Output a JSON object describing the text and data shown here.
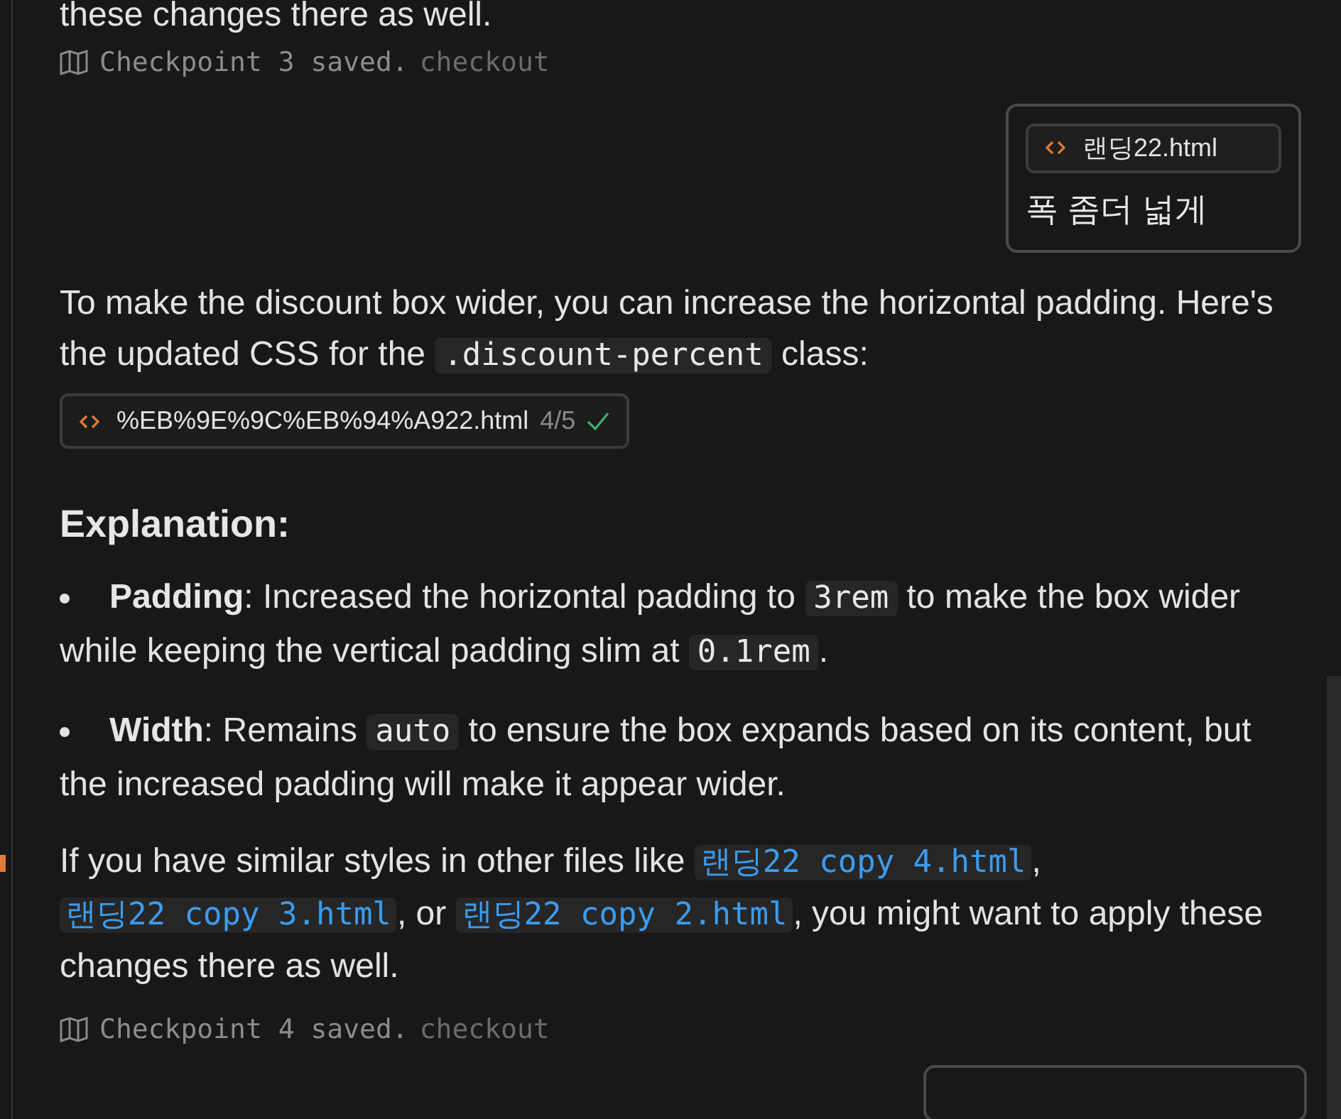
{
  "blocks": [
    {
      "kind": "paragraph",
      "segments": [
        {
          "kind": "text",
          "text": "these changes there as well."
        }
      ]
    },
    {
      "kind": "checkpoint",
      "text": "Checkpoint 3 saved.",
      "action": "checkout"
    },
    {
      "kind": "user_message",
      "file": "랜딩22.html",
      "text": "폭 좀더 넓게"
    },
    {
      "kind": "paragraph",
      "segments": [
        {
          "kind": "text",
          "text": "To make the discount box wider, you can increase the horizontal padding. Here's the updated CSS for the "
        },
        {
          "kind": "code",
          "text": ".discount-percent"
        },
        {
          "kind": "text",
          "text": " class:"
        }
      ]
    },
    {
      "kind": "file_chip",
      "file": "%EB%9E%9C%EB%94%A922.html",
      "count": "4/5",
      "applied": true
    },
    {
      "kind": "heading",
      "text": "Explanation:"
    },
    {
      "kind": "bullet",
      "segments": [
        {
          "kind": "bold",
          "text": "Padding"
        },
        {
          "kind": "text",
          "text": ": Increased the horizontal padding to "
        },
        {
          "kind": "code",
          "text": "3rem"
        },
        {
          "kind": "text",
          "text": " to make the box wider while keeping the vertical padding slim at "
        },
        {
          "kind": "code",
          "text": "0.1rem"
        },
        {
          "kind": "text",
          "text": "."
        }
      ]
    },
    {
      "kind": "bullet",
      "segments": [
        {
          "kind": "bold",
          "text": "Width"
        },
        {
          "kind": "text",
          "text": ": Remains "
        },
        {
          "kind": "code",
          "text": "auto"
        },
        {
          "kind": "text",
          "text": " to ensure the box expands based on its content, but the increased padding will make it appear wider."
        }
      ]
    },
    {
      "kind": "paragraph",
      "segments": [
        {
          "kind": "text",
          "text": "If you have similar styles in other files like "
        },
        {
          "kind": "link",
          "text": "랜딩22 copy 4.html"
        },
        {
          "kind": "text",
          "text": ", "
        },
        {
          "kind": "link",
          "text": "랜딩22 copy 3.html"
        },
        {
          "kind": "text",
          "text": ", or "
        },
        {
          "kind": "link",
          "text": "랜딩22 copy 2.html"
        },
        {
          "kind": "text",
          "text": ", you might want to apply these changes there as well."
        }
      ]
    },
    {
      "kind": "checkpoint",
      "text": "Checkpoint 4 saved.",
      "action": "checkout"
    }
  ]
}
